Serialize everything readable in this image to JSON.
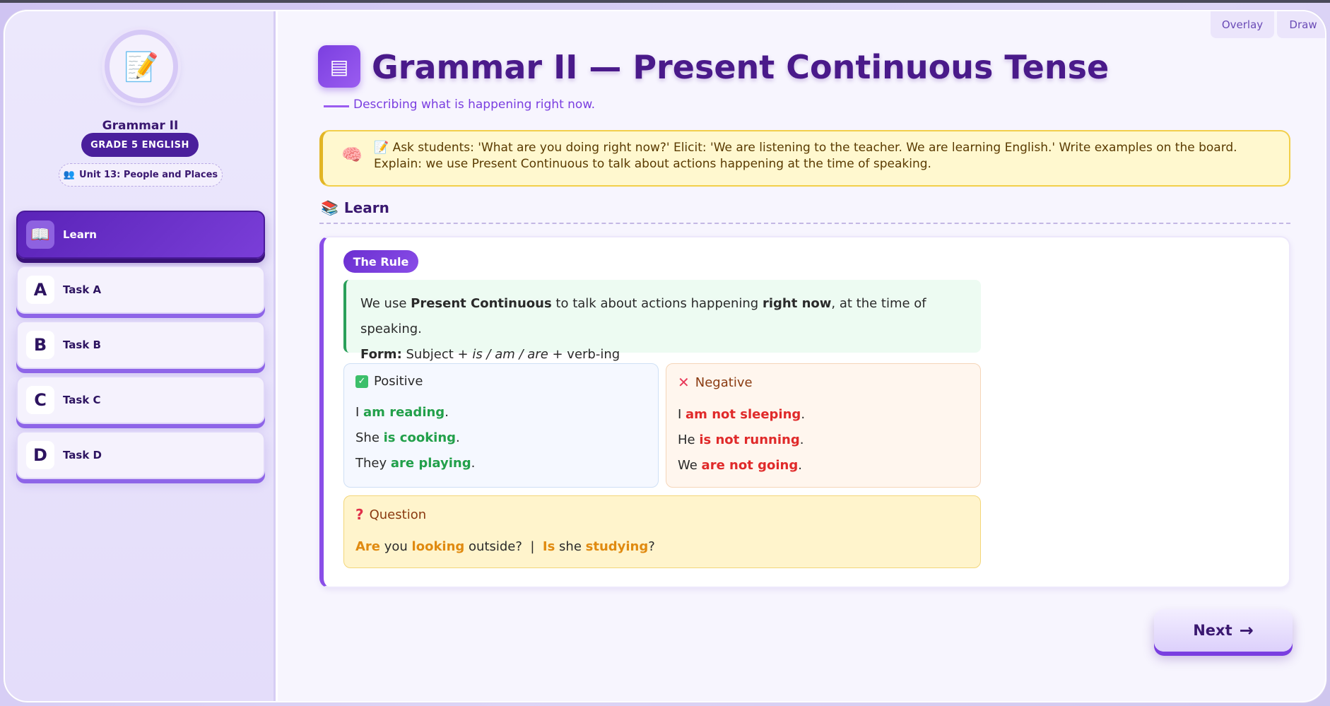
{
  "toolbar": {
    "overlay": "Overlay",
    "draw": "Draw"
  },
  "sidebar": {
    "title": "Grammar II",
    "grade": "GRADE 5 ENGLISH",
    "unit": "Unit 13: People and Places",
    "items": [
      {
        "badge": "📖",
        "label": "Learn",
        "active": true
      },
      {
        "badge": "A",
        "label": "Task A"
      },
      {
        "badge": "B",
        "label": "Task B"
      },
      {
        "badge": "C",
        "label": "Task C"
      },
      {
        "badge": "D",
        "label": "Task D"
      }
    ]
  },
  "main": {
    "title": "Grammar II — Present Continuous Tense",
    "subtitle": "Describing what is happening right now.",
    "teacher_note": "📝 Ask students: 'What are you doing right now?' Elicit: 'We are listening to the teacher. We are learning English.' Write examples on the board. Explain: we use Present Continuous to talk about actions happening at the time of speaking.",
    "section": "Learn",
    "rule_pill": "The Rule",
    "rule": {
      "a": "We use ",
      "b": "Present Continuous",
      "c": " to talk about actions happening ",
      "d": "right now",
      "e": ", at the time of speaking.",
      "form_label": "Form:",
      "form_a": " Subject + ",
      "form_b": "is / am / are",
      "form_c": " + verb-ing"
    },
    "positive": {
      "heading": "Positive",
      "lines": [
        [
          "I ",
          "am reading",
          "."
        ],
        [
          "She ",
          "is cooking",
          "."
        ],
        [
          "They ",
          "are playing",
          "."
        ]
      ]
    },
    "negative": {
      "heading": "Negative",
      "lines": [
        [
          "I ",
          "am not sleeping",
          "."
        ],
        [
          "He ",
          "is not running",
          "."
        ],
        [
          "We ",
          "are not going",
          "."
        ]
      ]
    },
    "question": {
      "heading": "Question",
      "q1a": "Are",
      "q1b": " you ",
      "q1c": "looking",
      "q1d": " outside?  |  ",
      "q2a": "Is",
      "q2b": " she ",
      "q2c": "studying",
      "q2d": "?"
    },
    "next": "Next"
  },
  "icons": {
    "header": "book-icon",
    "teacher": "brain-icon",
    "section": "books-icon",
    "positive": "check-icon",
    "negative": "cross-icon",
    "question": "question-icon",
    "next": "arrow-right-icon"
  },
  "colors": {
    "accent": "#7b3fe0",
    "positive": "#22a04a",
    "negative": "#e02a2a",
    "question": "#e08a10",
    "note": "#fff8cf"
  }
}
